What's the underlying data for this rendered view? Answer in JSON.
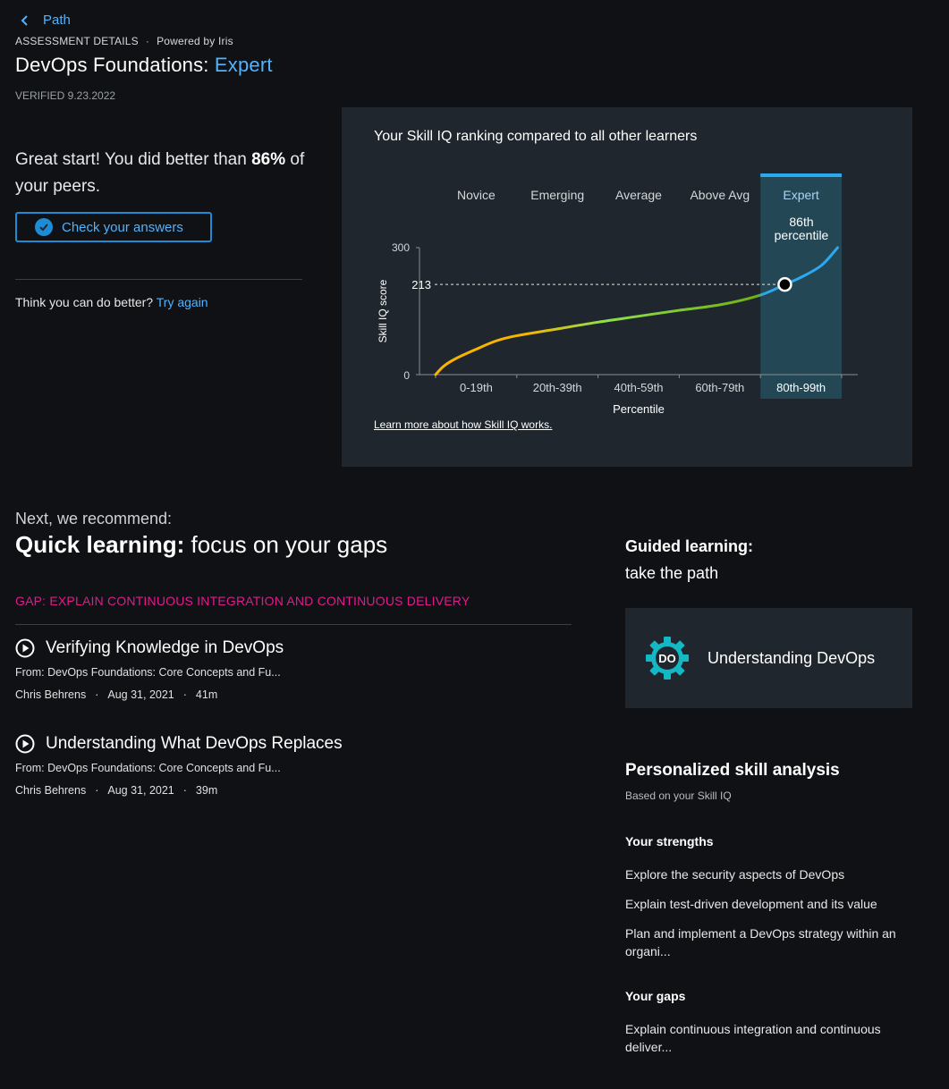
{
  "header": {
    "back_label": "Path",
    "section_label": "ASSESSMENT DETAILS",
    "powered_by": "Powered by Iris",
    "title_prefix": "DevOps Foundations:",
    "title_level": "Expert",
    "verified": "VERIFIED 9.23.2022"
  },
  "result": {
    "text_before": "Great start! You did better than ",
    "percent": "86%",
    "text_after": " of your peers.",
    "check_button": "Check your answers",
    "retry_prompt": "Think you can do better?",
    "retry_link": "Try again"
  },
  "chart_panel": {
    "title": "Your Skill IQ ranking compared to all other learners",
    "learn_more": "Learn more about how Skill IQ works."
  },
  "chart_data": {
    "type": "line",
    "bands": [
      "Novice",
      "Emerging",
      "Average",
      "Above Avg",
      "Expert"
    ],
    "categories": [
      "0-19th",
      "20th-39th",
      "40th-59th",
      "60th-79th",
      "80th-99th"
    ],
    "xlabel": "Percentile",
    "ylabel": "Skill IQ score",
    "ylim": [
      0,
      300
    ],
    "yticks": [
      "300",
      "0"
    ],
    "highlight_band": "Expert",
    "marker": {
      "percentile": 86,
      "score": 213,
      "score_label": "213",
      "label_line1": "86th",
      "label_line2": "percentile"
    },
    "curve": {
      "x": [
        0,
        2,
        5,
        10,
        15,
        20,
        30,
        40,
        50,
        60,
        70,
        80,
        86,
        90,
        95,
        99
      ],
      "y": [
        0,
        20,
        38,
        60,
        80,
        92,
        108,
        124,
        138,
        152,
        165,
        188,
        213,
        230,
        258,
        300
      ]
    },
    "colors": {
      "start": "#f7b500",
      "mid": "#8fe04a",
      "end": "#6fb017",
      "expert": "#2aa9f0",
      "highlight_bg": "#234755"
    }
  },
  "recommend": {
    "next_label": "Next, we recommend:",
    "quick_bold": "Quick learning:",
    "quick_rest": " focus on your gaps",
    "gap_label": "GAP: EXPLAIN CONTINUOUS INTEGRATION AND CONTINUOUS DELIVERY",
    "courses": [
      {
        "title": "Verifying Knowledge in DevOps",
        "from": "From: DevOps Foundations: Core Concepts and Fu...",
        "author": "Chris Behrens",
        "date": "Aug 31, 2021",
        "duration": "41m"
      },
      {
        "title": "Understanding What DevOps Replaces",
        "from": "From: DevOps Foundations: Core Concepts and Fu...",
        "author": "Chris Behrens",
        "date": "Aug 31, 2021",
        "duration": "39m"
      }
    ]
  },
  "guided": {
    "bold": "Guided learning:",
    "rest": "take the path",
    "path_name": "Understanding DevOps",
    "path_logo_text": "DO"
  },
  "analysis": {
    "title": "Personalized skill analysis",
    "subtitle": "Based on your Skill IQ",
    "strengths_heading": "Your strengths",
    "strengths": [
      "Explore the security aspects of DevOps",
      "Explain test-driven development and its value",
      "Plan and implement a DevOps strategy within an organi..."
    ],
    "gaps_heading": "Your gaps",
    "gaps": [
      "Explain continuous integration and continuous deliver..."
    ]
  }
}
